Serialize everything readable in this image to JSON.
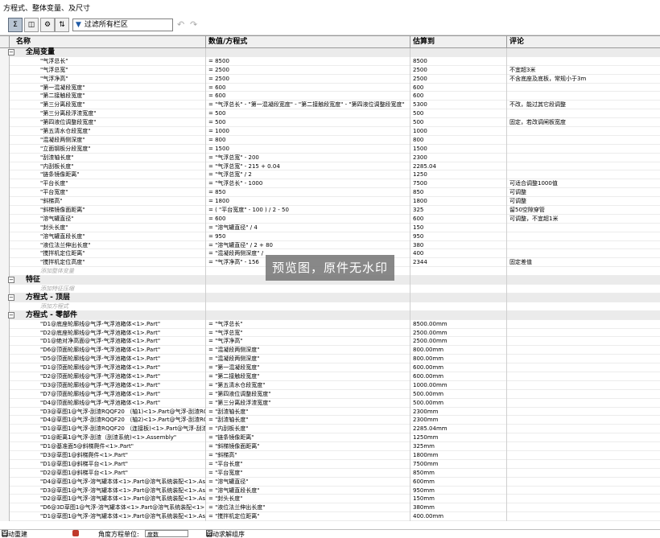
{
  "window": {
    "title": "方程式、整体变量、及尺寸"
  },
  "toolbar": {
    "filter_placeholder": "过滤所有栏区",
    "filter_icon": "funnel-icon",
    "btn1": "Σ",
    "btn2": "◫",
    "btn3": "⚙",
    "btn4": "⇅",
    "undo": "↶",
    "redo": "↷"
  },
  "columns": {
    "name": "名称",
    "value": "数值/方程式",
    "evaluates": "估算到",
    "comment": "评论"
  },
  "rows": [
    {
      "type": "group",
      "name": "全局变量",
      "exp": "−"
    },
    {
      "name": "\"气浮总长\"",
      "value": "= 8500",
      "eval": "8500",
      "comment": ""
    },
    {
      "name": "\"气浮总宽\"",
      "value": "= 2500",
      "eval": "2500",
      "comment": "不宜超3米"
    },
    {
      "name": "\"气浮净高\"",
      "value": "= 2500",
      "eval": "2500",
      "comment": "不含底座及底板，常规小于3m"
    },
    {
      "name": "\"第一混凝段宽度\"",
      "value": "= 600",
      "eval": "600",
      "comment": ""
    },
    {
      "name": "\"第二接触段宽度\"",
      "value": "= 600",
      "eval": "600",
      "comment": ""
    },
    {
      "name": "\"第三分离段宽度\"",
      "value": "= \"气浮总长\" - \"第一混凝段宽度\" - \"第二接触段宽度\" - \"第四液位调整段宽度\"",
      "eval": "5300",
      "comment": "不改，能过其它段调整"
    },
    {
      "name": "\"第三分离段浮渣宽度\"",
      "value": "= 500",
      "eval": "500",
      "comment": ""
    },
    {
      "name": "\"第四液位调整段宽度\"",
      "value": "= 500",
      "eval": "500",
      "comment": "固定，若改调闸板宽度"
    },
    {
      "name": "\"第五清水仓段宽度\"",
      "value": "= 1000",
      "eval": "1000",
      "comment": ""
    },
    {
      "name": "\"混凝段两侧深度\"",
      "value": "= 800",
      "eval": "800",
      "comment": ""
    },
    {
      "name": "\"立面钢板分段宽度\"",
      "value": "= 1500",
      "eval": "1500",
      "comment": ""
    },
    {
      "name": "\"刮渣轴长度\"",
      "value": "= \"气浮总宽\" - 200",
      "eval": "2300",
      "comment": ""
    },
    {
      "name": "\"内刮板长度\"",
      "value": "= \"气浮总宽\" - 215 + 0.04",
      "eval": "2285.04",
      "comment": ""
    },
    {
      "name": "\"链条镜像距离\"",
      "value": "= \"气浮总宽\" / 2",
      "eval": "1250",
      "comment": ""
    },
    {
      "name": "\"平台长度\"",
      "value": "= \"气浮总长\" - 1000",
      "eval": "7500",
      "comment": "可适合调整1000值"
    },
    {
      "name": "\"平台宽度\"",
      "value": "= 850",
      "eval": "850",
      "comment": "可调整"
    },
    {
      "name": "\"斜梯高\"",
      "value": "= 1800",
      "eval": "1800",
      "comment": "可调整"
    },
    {
      "name": "\"斜梯镜像面距离\"",
      "value": "= ( \"平台宽度\" - 100 ) / 2 - 50",
      "eval": "325",
      "comment": "留50空隙穿管"
    },
    {
      "name": "\"溶气罐直径\"",
      "value": "= 600",
      "eval": "600",
      "comment": "可调整，不宜超1米"
    },
    {
      "name": "\"封头长度\"",
      "value": "= \"溶气罐直径\" / 4",
      "eval": "150",
      "comment": ""
    },
    {
      "name": "\"溶气罐直段长度\"",
      "value": "= 950",
      "eval": "950",
      "comment": ""
    },
    {
      "name": "\"液位法兰伸出长度\"",
      "value": "= \"溶气罐直径\" / 2 + 80",
      "eval": "380",
      "comment": ""
    },
    {
      "name": "\"搅拌机定位距离\"",
      "value": "= \"混凝段两侧深度\" /",
      "eval": "400",
      "comment": ""
    },
    {
      "name": "\"搅拌机定位高度\"",
      "value": "= \"气浮净高\" - 156",
      "eval": "2344",
      "comment": "固定差值"
    },
    {
      "type": "placeholder",
      "name": "添加整体变量"
    },
    {
      "type": "group",
      "name": "特征",
      "exp": "−"
    },
    {
      "type": "placeholder",
      "name": "添加特征压缩"
    },
    {
      "type": "group",
      "name": "方程式 - 顶层",
      "exp": "−"
    },
    {
      "type": "placeholder",
      "name": "添加方程式"
    },
    {
      "type": "group",
      "name": "方程式 - 零部件",
      "exp": "−"
    },
    {
      "name": "\"D1@底座轮廓线@气浮-气浮池箱体<1>.Part\"",
      "value": "= \"气浮总长\"",
      "eval": "8500.00mm",
      "comment": ""
    },
    {
      "name": "\"D2@底座轮廓线@气浮-气浮池箱体<1>.Part\"",
      "value": "= \"气浮总宽\"",
      "eval": "2500.00mm",
      "comment": ""
    },
    {
      "name": "\"D1@绝对净高面@气浮-气浮池箱体<1>.Part\"",
      "value": "= \"气浮净高\"",
      "eval": "2500.00mm",
      "comment": ""
    },
    {
      "name": "\"D6@顶面轮廓线@气浮-气浮池箱体<1>.Part\"",
      "value": "= \"混凝段两侧深度\"",
      "eval": "800.00mm",
      "comment": ""
    },
    {
      "name": "\"D5@顶面轮廓线@气浮-气浮池箱体<1>.Part\"",
      "value": "= \"混凝段两侧深度\"",
      "eval": "800.00mm",
      "comment": ""
    },
    {
      "name": "\"D1@顶面轮廓线@气浮-气浮池箱体<1>.Part\"",
      "value": "= \"第一混凝段宽度\"",
      "eval": "600.00mm",
      "comment": ""
    },
    {
      "name": "\"D2@顶面轮廓线@气浮-气浮池箱体<1>.Part\"",
      "value": "= \"第二接触段宽度\"",
      "eval": "600.00mm",
      "comment": ""
    },
    {
      "name": "\"D3@顶面轮廓线@气浮-气浮池箱体<1>.Part\"",
      "value": "= \"第五清水仓段宽度\"",
      "eval": "1000.00mm",
      "comment": ""
    },
    {
      "name": "\"D7@顶面轮廓线@气浮-气浮池箱体<1>.Part\"",
      "value": "= \"第四液位调整段宽度\"",
      "eval": "500.00mm",
      "comment": ""
    },
    {
      "name": "\"D4@顶面轮廓线@气浮-气浮池箱体<1>.Part\"",
      "value": "= \"第三分离段浮渣宽度\"",
      "eval": "500.00mm",
      "comment": ""
    },
    {
      "name": "\"D3@草图1@气浮-刮渣RQQF20 （轴1)<1>.Part@气浮-刮渣RQQ",
      "value": "= \"刮渣轴长度\"",
      "eval": "2300mm",
      "comment": ""
    },
    {
      "name": "\"D4@草图1@气浮-刮渣RQQF20 （轴2)<1>.Part@气浮-刮渣RQQ",
      "value": "= \"刮渣轴长度\"",
      "eval": "2300mm",
      "comment": ""
    },
    {
      "name": "\"D1@草图1@气浮-刮渣RQQF20 （连接板)<1>.Part@气浮-刮渣R",
      "value": "= \"内刮板长度\"",
      "eval": "2285.04mm",
      "comment": ""
    },
    {
      "name": "\"D1@距离1@气浮-刮渣（刮渣系统)<1>.Assembly\"",
      "value": "= \"链条镜像距离\"",
      "eval": "1250mm",
      "comment": ""
    },
    {
      "name": "\"D1@基准面5@斜梯爬件<1>.Part\"",
      "value": "= \"斜梯镜像面距离\"",
      "eval": "325mm",
      "comment": ""
    },
    {
      "name": "\"D3@草图1@斜梯爬件<1>.Part\"",
      "value": "= \"斜梯高\"",
      "eval": "1800mm",
      "comment": ""
    },
    {
      "name": "\"D1@草图1@斜梯平台<1>.Part\"",
      "value": "= \"平台长度\"",
      "eval": "7500mm",
      "comment": ""
    },
    {
      "name": "\"D2@草图1@斜梯平台<1>.Part\"",
      "value": "= \"平台宽度\"",
      "eval": "850mm",
      "comment": ""
    },
    {
      "name": "\"D4@草图1@气浮-溶气罐本体<1>.Part@溶气系统装配<1>.Asse",
      "value": "= \"溶气罐直径\"",
      "eval": "600mm",
      "comment": ""
    },
    {
      "name": "\"D3@草图1@气浮-溶气罐本体<1>.Part@溶气系统装配<1>.Asse",
      "value": "= \"溶气罐直段长度\"",
      "eval": "950mm",
      "comment": ""
    },
    {
      "name": "\"D2@草图1@气浮-溶气罐本体<1>.Part@溶气系统装配<1>.Asse",
      "value": "= \"封头长度\"",
      "eval": "150mm",
      "comment": ""
    },
    {
      "name": "\"D6@3D草图1@气浮-溶气罐本体<1>.Part@溶气系统装配<1>.As",
      "value": "= \"液位法兰伸出长度\"",
      "eval": "380mm",
      "comment": ""
    },
    {
      "name": "\"D1@草图1@气浮-溶气罐本体<1>.Part@溶气系统装配<1>.Asse",
      "value": "= \"搅拌机定位距离\"",
      "eval": "400.00mm",
      "comment": ""
    }
  ],
  "watermark": "预览图，原件无水印",
  "status": {
    "auto_rebuild": "自动重建",
    "unit_label": "角度方程单位:",
    "unit_value": "度数",
    "auto_solve": "自动求解组序"
  }
}
